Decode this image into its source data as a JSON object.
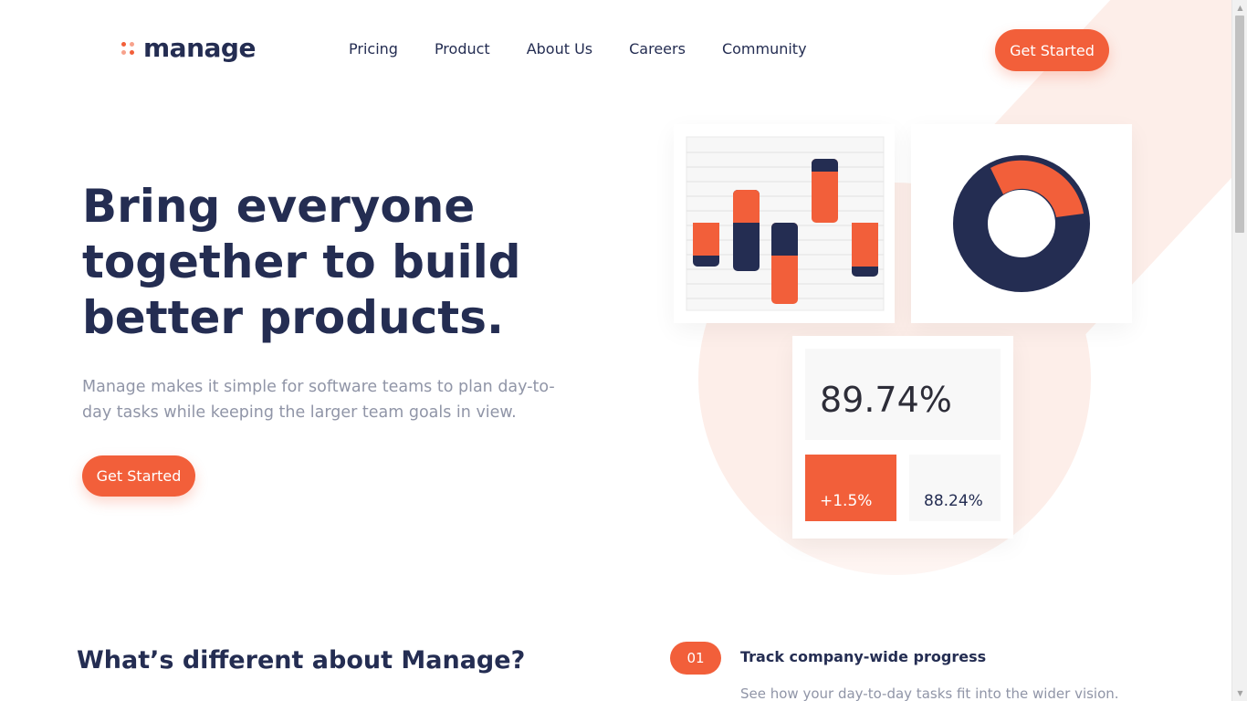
{
  "brand": {
    "name": "manage",
    "accent_color": "#f25f3a",
    "navy_color": "#242d52",
    "dot_colors": [
      "#f25f3a",
      "#f7a28c",
      "#f7a28c",
      "#f25f3a"
    ]
  },
  "nav": {
    "items": [
      "Pricing",
      "Product",
      "About Us",
      "Careers",
      "Community"
    ],
    "cta_label": "Get Started"
  },
  "hero": {
    "title_lines": [
      "Bring everyone",
      "together to build",
      "better products."
    ],
    "subtitle": "Manage makes it simple for software teams to plan day-to-day tasks while keeping the larger team goals in view.",
    "cta_label": "Get Started"
  },
  "stats": {
    "main": "89.74%",
    "change": "+1.5%",
    "secondary": "88.24%"
  },
  "features": {
    "section_title": "What’s different about Manage?",
    "items": [
      {
        "number": "01",
        "title": "Track company-wide progress",
        "description": "See how your day-to-day tasks fit into the wider vision."
      }
    ]
  },
  "icons": {
    "scroll_up": "scroll-up-arrow-icon",
    "scroll_down": "scroll-down-arrow-icon"
  }
}
